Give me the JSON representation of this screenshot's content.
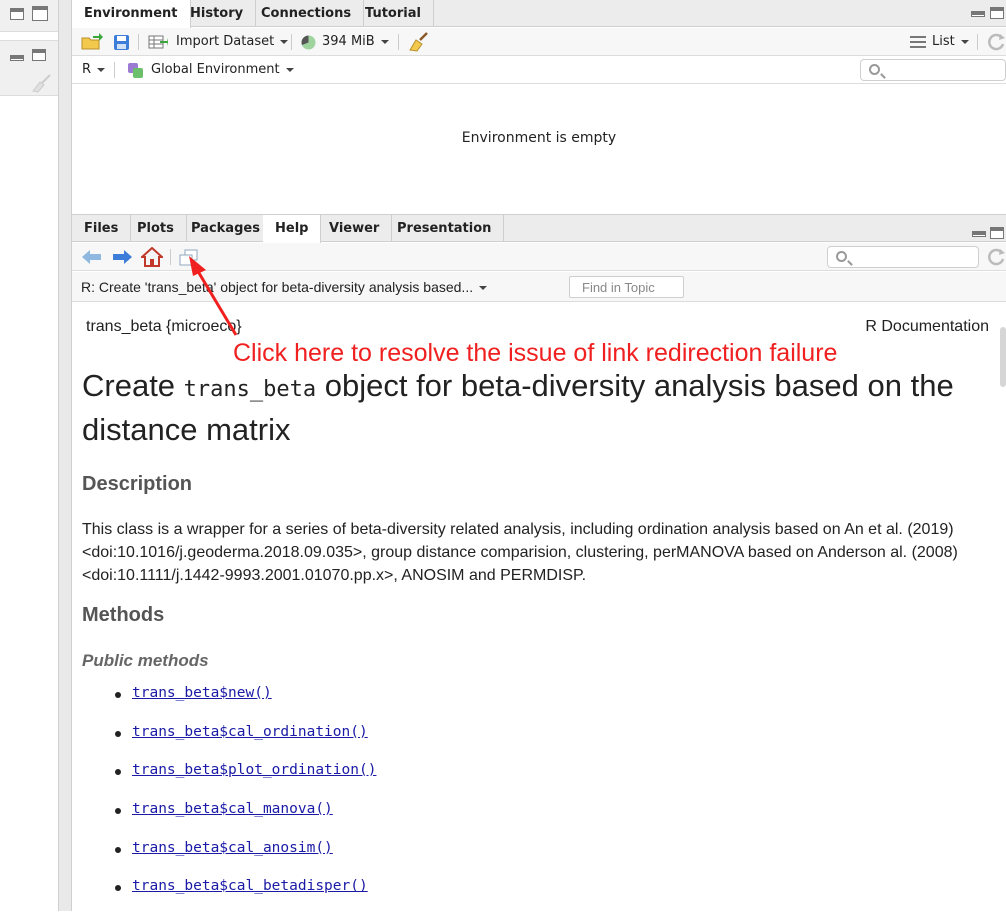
{
  "env": {
    "tabs": [
      "Environment",
      "History",
      "Connections",
      "Tutorial"
    ],
    "import_label": "Import Dataset",
    "memory_label": "394 MiB",
    "view_mode": "List",
    "lang": "R",
    "scope": "Global Environment",
    "empty_msg": "Environment is empty"
  },
  "help": {
    "tabs": [
      "Files",
      "Plots",
      "Packages",
      "Help",
      "Viewer",
      "Presentation"
    ],
    "topic": "R: Create 'trans_beta' object for beta-diversity analysis based...",
    "find_placeholder": "Find in Topic",
    "doc_left": "trans_beta {microeco}",
    "doc_right": "R Documentation",
    "title_pre": "Create ",
    "title_code": "trans_beta",
    "title_post": " object for beta-diversity analysis based on the distance matrix",
    "desc_heading": "Description",
    "desc_text": "This class is a wrapper for a series of beta-diversity related analysis, including ordination analysis based on An et al. (2019) <doi:10.1016/j.geoderma.2018.09.035>, group distance comparision, clustering, perMANOVA based on Anderson al. (2008) <doi:10.1111/j.1442-9993.2001.01070.pp.x>, ANOSIM and PERMDISP.",
    "methods_heading": "Methods",
    "public_heading": "Public methods",
    "methods": [
      "trans_beta$new()",
      "trans_beta$cal_ordination()",
      "trans_beta$plot_ordination()",
      "trans_beta$cal_manova()",
      "trans_beta$cal_anosim()",
      "trans_beta$cal_betadisper()"
    ]
  },
  "annotation": {
    "text": "Click here to resolve the issue of link redirection failure",
    "color": "#f02020"
  }
}
